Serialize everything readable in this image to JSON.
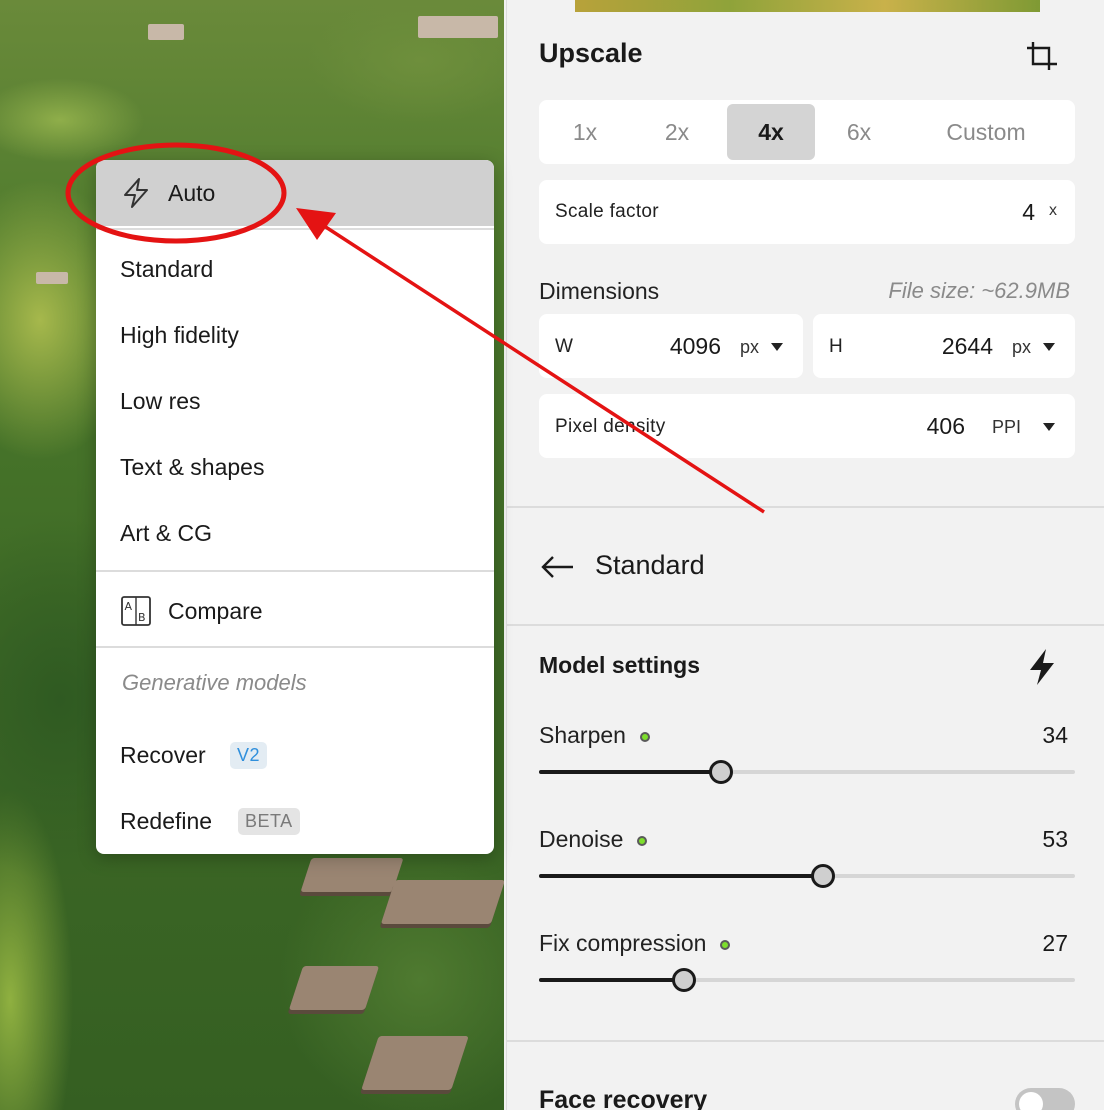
{
  "colors": {
    "accent_red": "#e41313",
    "dot_green": "#7dde2c",
    "badge_blue": "#2f8fdc"
  },
  "panel": {
    "title": "Upscale",
    "crop_icon": "crop-icon",
    "scale_options": [
      "1x",
      "2x",
      "4x",
      "6x",
      "Custom"
    ],
    "scale_selected": "4x",
    "scale_factor": {
      "label": "Scale factor",
      "value": "4",
      "unit": "x"
    },
    "dimensions": {
      "label": "Dimensions",
      "file_size": "File size: ~62.9MB",
      "width": {
        "label": "W",
        "value": "4096",
        "unit": "px"
      },
      "height": {
        "label": "H",
        "value": "2644",
        "unit": "px"
      }
    },
    "pixel_density": {
      "label": "Pixel density",
      "value": "406",
      "unit": "PPI"
    },
    "model": {
      "back_icon": "arrow-left-icon",
      "name": "Standard"
    },
    "model_settings": {
      "title": "Model settings",
      "icon": "lightning-bolt-icon",
      "sliders": [
        {
          "label": "Sharpen",
          "value": 34,
          "level": 0.34
        },
        {
          "label": "Denoise",
          "value": 53,
          "level": 0.53
        },
        {
          "label": "Fix compression",
          "value": 27,
          "level": 0.27
        }
      ]
    },
    "face_recovery": {
      "title": "Face recovery",
      "enabled": false
    }
  },
  "menu": {
    "items": [
      {
        "label": "Auto",
        "icon": "lightning-outline-icon",
        "selected": true
      },
      {
        "label": "Standard"
      },
      {
        "label": "High fidelity"
      },
      {
        "label": "Low res"
      },
      {
        "label": "Text & shapes"
      },
      {
        "label": "Art & CG"
      }
    ],
    "compare": {
      "label": "Compare",
      "icon": "ab-compare-icon"
    },
    "generative_heading": "Generative models",
    "recover": {
      "label": "Recover",
      "badge": "V2"
    },
    "redefine": {
      "label": "Redefine",
      "badge": "BETA"
    }
  }
}
